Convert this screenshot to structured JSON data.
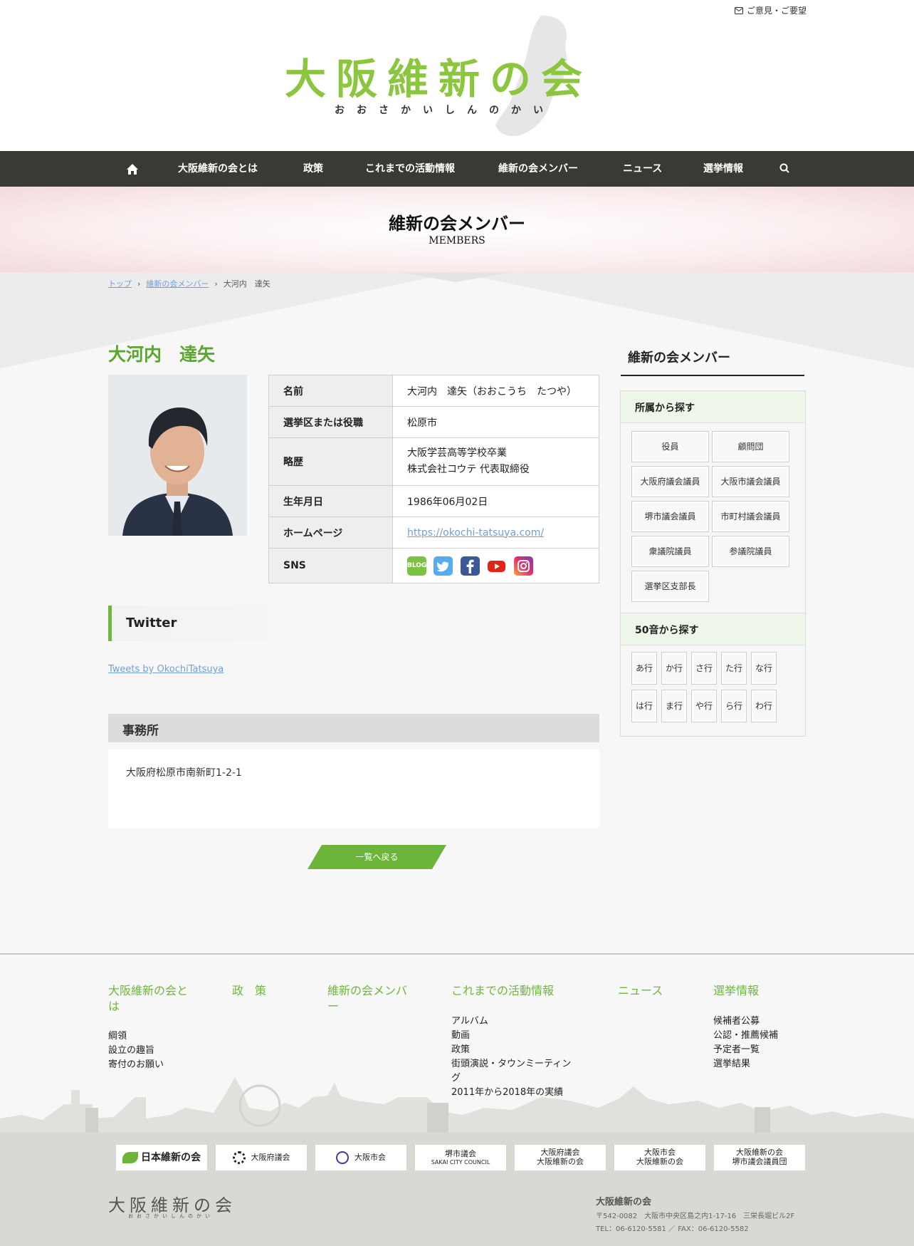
{
  "header": {
    "feedback_label": "ご意見・ご要望",
    "logo_text": "大阪維新の会",
    "logo_kana": "おおさかいしんのかい"
  },
  "nav": {
    "items": [
      "大阪維新の会とは",
      "政策",
      "これまでの活動情報",
      "維新の会メンバー",
      "ニュース",
      "選挙情報"
    ]
  },
  "page_header": {
    "title": "維新の会メンバー",
    "subtitle": "MEMBERS"
  },
  "breadcrumb": {
    "top": "トップ",
    "members": "維新の会メンバー",
    "current": "大河内　達矢"
  },
  "member": {
    "name": "大河内　達矢",
    "profile": [
      {
        "label": "名前",
        "value": "大河内　達矢（おおこうち　たつや）"
      },
      {
        "label": "選挙区または役職",
        "value": "松原市"
      },
      {
        "label": "略歴",
        "value_lines": [
          "大阪学芸高等学校卒業",
          "株式会社コウテ 代表取締役"
        ]
      },
      {
        "label": "生年月日",
        "value": "1986年06月02日"
      },
      {
        "label": "ホームページ",
        "value": "https://okochi-tatsuya.com/"
      },
      {
        "label": "SNS"
      }
    ],
    "sns": [
      {
        "name": "blog",
        "label": "BLOG",
        "color": "#7cc242"
      },
      {
        "name": "twitter",
        "color": "#55acee"
      },
      {
        "name": "facebook",
        "color": "#3b5998"
      },
      {
        "name": "youtube",
        "color": "#e62117"
      },
      {
        "name": "instagram",
        "color": "#c13584"
      }
    ]
  },
  "twitter": {
    "heading": "Twitter",
    "link": "Tweets by OkochiTatsuya"
  },
  "office": {
    "heading": "事務所",
    "address": "大阪府松原市南新町1-2-1"
  },
  "back_button": "一覧へ戻る",
  "sidebar": {
    "title": "維新の会メンバー",
    "affiliation_heading": "所属から探す",
    "affiliations": [
      "役員",
      "顧問団",
      "大阪府議会議員",
      "大阪市議会議員",
      "堺市議会議員",
      "市町村議会議員",
      "衆議院議員",
      "参議院議員",
      "選挙区支部長"
    ],
    "kana_heading": "50音から探す",
    "kana": [
      "あ行",
      "か行",
      "さ行",
      "た行",
      "な行",
      "は行",
      "ま行",
      "や行",
      "ら行",
      "わ行"
    ]
  },
  "footer": {
    "columns": [
      {
        "title": "大阪維新の会とは",
        "links": [
          "綱領",
          "設立の趣旨",
          "寄付のお願い"
        ]
      },
      {
        "title": "政　策",
        "links": []
      },
      {
        "title": "維新の会メンバー",
        "links": []
      },
      {
        "title": "これまでの活動情報",
        "links": [
          "アルバム",
          "動画",
          "政策",
          "街頭演説・タウンミーティング",
          "2011年から2018年の実績"
        ]
      },
      {
        "title": "ニュース",
        "links": []
      },
      {
        "title": "選挙情報",
        "links": [
          "候補者公募",
          "公認・推薦候補",
          "予定者一覧",
          "選挙結果"
        ]
      }
    ],
    "partners": [
      "日本維新の会",
      "大阪府議会",
      "大阪市会",
      [
        "堺市議会",
        "SAKAI CITY COUNCIL"
      ],
      [
        "大阪府議会",
        "大阪維新の会"
      ],
      [
        "大阪市会",
        "大阪維新の会"
      ],
      [
        "大阪維新の会",
        "堺市議会議員団"
      ]
    ],
    "org_name": "大阪維新の会",
    "address": "〒542-0082　大阪市中央区島之内1-17-16　三栄長堀ビル2F",
    "tel": "TEL：06-6120-5581 ／ FAX：06-6120-5582",
    "logo_text": "大阪維新の会",
    "logo_kana": "おおさかいしんのかい"
  },
  "colors": {
    "accent": "#6fb63c",
    "nav_bg": "#383a33",
    "name_green": "#5aa62e"
  }
}
